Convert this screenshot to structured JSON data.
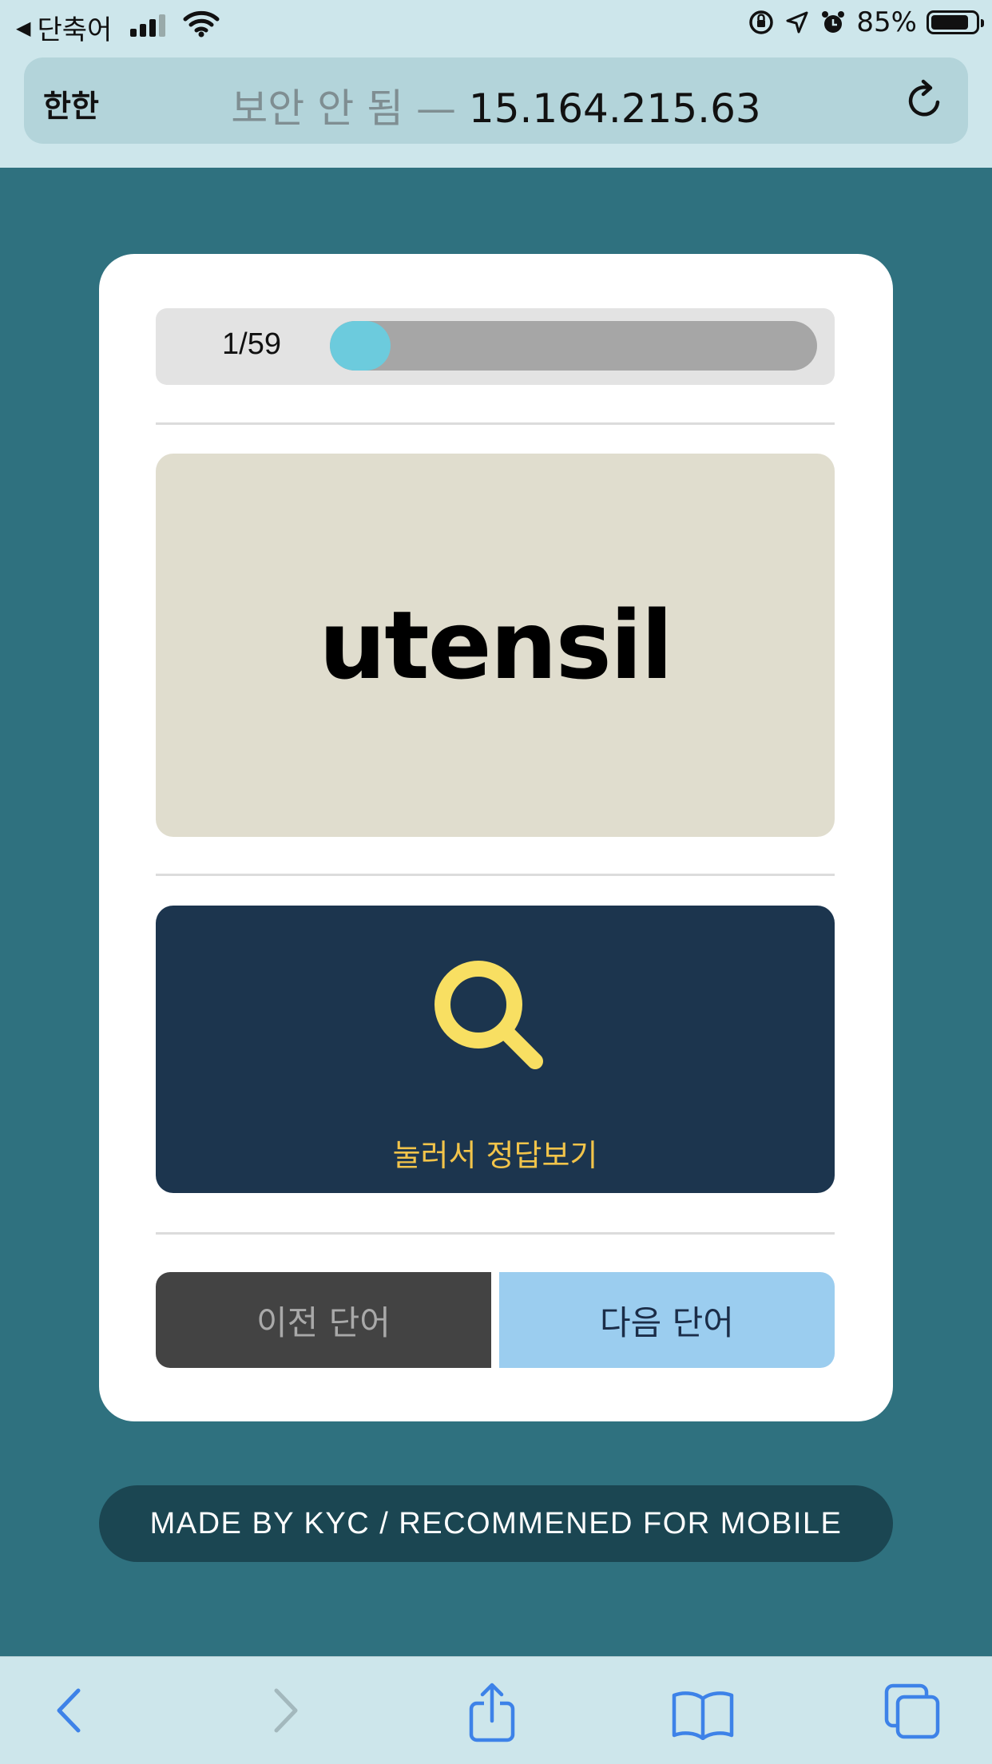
{
  "status_bar": {
    "back_app_label": "단축어",
    "battery_percent": "85%",
    "battery_level": 0.85
  },
  "address_bar": {
    "reader_button": "한한",
    "insecure_label": "보안 안 됨 —",
    "host": "15.164.215.63"
  },
  "quiz": {
    "progress_label": "1/59",
    "progress_current": 1,
    "progress_total": 59,
    "word": "utensil",
    "reveal_label": "눌러서 정답보기",
    "prev_label": "이전 단어",
    "next_label": "다음 단어"
  },
  "footer": {
    "text": "MADE BY KYC / RECOMMENED FOR MOBILE"
  },
  "toolbar": {
    "icons": [
      "back-icon",
      "forward-icon",
      "share-icon",
      "bookmarks-icon",
      "tabs-icon"
    ]
  },
  "colors": {
    "page_bg": "#2f717f",
    "progress_fill": "#6ccbdd",
    "word_panel": "#e0ddce",
    "answer_panel": "#1c354e",
    "answer_accent": "#f2c44a",
    "next_button": "#9bcdef",
    "prev_button": "#434343"
  }
}
